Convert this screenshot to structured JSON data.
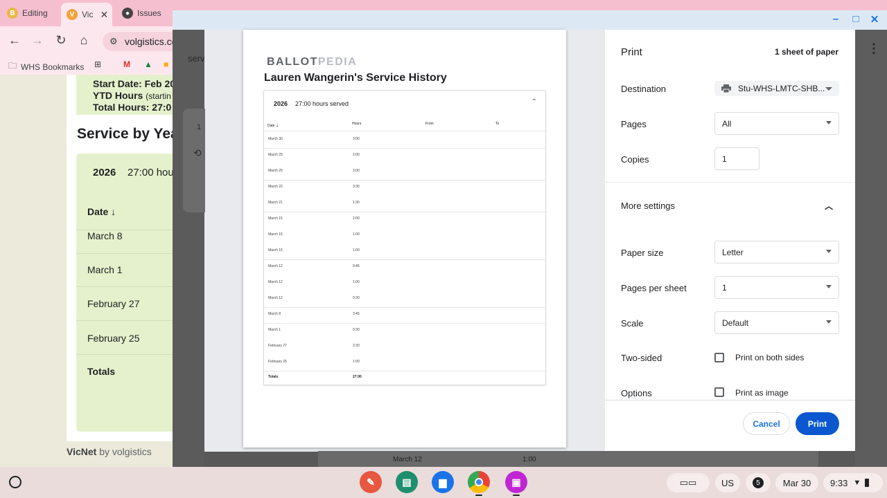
{
  "browser": {
    "tabs": [
      {
        "label": "Editing",
        "icon": "ballotpedia-icon",
        "color": "#e8b84a"
      },
      {
        "label": "Vic",
        "icon": "volgistics-icon",
        "color": "#f4a13a",
        "active": true
      },
      {
        "label": "Issues",
        "icon": "github-icon",
        "color": "#444"
      }
    ],
    "url": "volgistics.co",
    "bookmarks_label": "WHS Bookmarks",
    "window_label": "serv"
  },
  "background_page": {
    "start_date": "Start Date: Feb 20",
    "ytd_hours": "YTD Hours",
    "ytd_suffix": "(startin",
    "total_hours": "Total Hours: 27:0",
    "service_heading": "Service by Yea",
    "year": "2026",
    "year_hours": "27:00 hou",
    "date_col": "Date",
    "rows": [
      "March 8",
      "March 1",
      "February 27",
      "February 25"
    ],
    "totals": "Totals",
    "page_num": "1",
    "footer_brand": "VicNet",
    "footer_by": "by volgistics"
  },
  "preview": {
    "logo_dark": "BALLOT",
    "logo_light": "PEDIA",
    "title": "Lauren Wangerin's Service History",
    "year": "2026",
    "hours_served": "27:00 hours served",
    "columns": [
      "Date",
      "Hours",
      "From",
      "To"
    ],
    "rows": [
      {
        "date": "March 30",
        "hours": "3:00"
      },
      {
        "date": "March 29",
        "hours": "2:00"
      },
      {
        "date": "March 29",
        "hours": "3:00"
      },
      {
        "date": "March 22",
        "hours": "3:30"
      },
      {
        "date": "March 21",
        "hours": "1:30"
      },
      {
        "date": "March 15",
        "hours": "2:00"
      },
      {
        "date": "March 15",
        "hours": "1:00"
      },
      {
        "date": "March 15",
        "hours": "1:00"
      },
      {
        "date": "March 12",
        "hours": "0:45"
      },
      {
        "date": "March 12",
        "hours": "1:00"
      },
      {
        "date": "March 12",
        "hours": "0:30"
      },
      {
        "date": "March 8",
        "hours": "3:45"
      },
      {
        "date": "March 1",
        "hours": "0:30"
      },
      {
        "date": "February 27",
        "hours": "2:30"
      },
      {
        "date": "February 25",
        "hours": "1:00"
      }
    ],
    "totals_label": "Totals",
    "totals_value": "27:00"
  },
  "print_panel": {
    "title": "Print",
    "sheets": "1 sheet of paper",
    "destination_label": "Destination",
    "destination_value": "Stu-WHS-LMTC-SHB...",
    "pages_label": "Pages",
    "pages_value": "All",
    "copies_label": "Copies",
    "copies_value": "1",
    "more_settings": "More settings",
    "paper_size_label": "Paper size",
    "paper_size_value": "Letter",
    "pps_label": "Pages per sheet",
    "pps_value": "1",
    "scale_label": "Scale",
    "scale_value": "Default",
    "two_sided_label": "Two-sided",
    "two_sided_option": "Print on both sides",
    "options_label": "Options",
    "options_option": "Print as image",
    "cancel": "Cancel",
    "print": "Print"
  },
  "behind": {
    "date": "March 12",
    "hours": "1:00"
  },
  "shelf": {
    "locale": "US",
    "notifications": "5",
    "date": "Mar 30",
    "time": "9:33"
  }
}
